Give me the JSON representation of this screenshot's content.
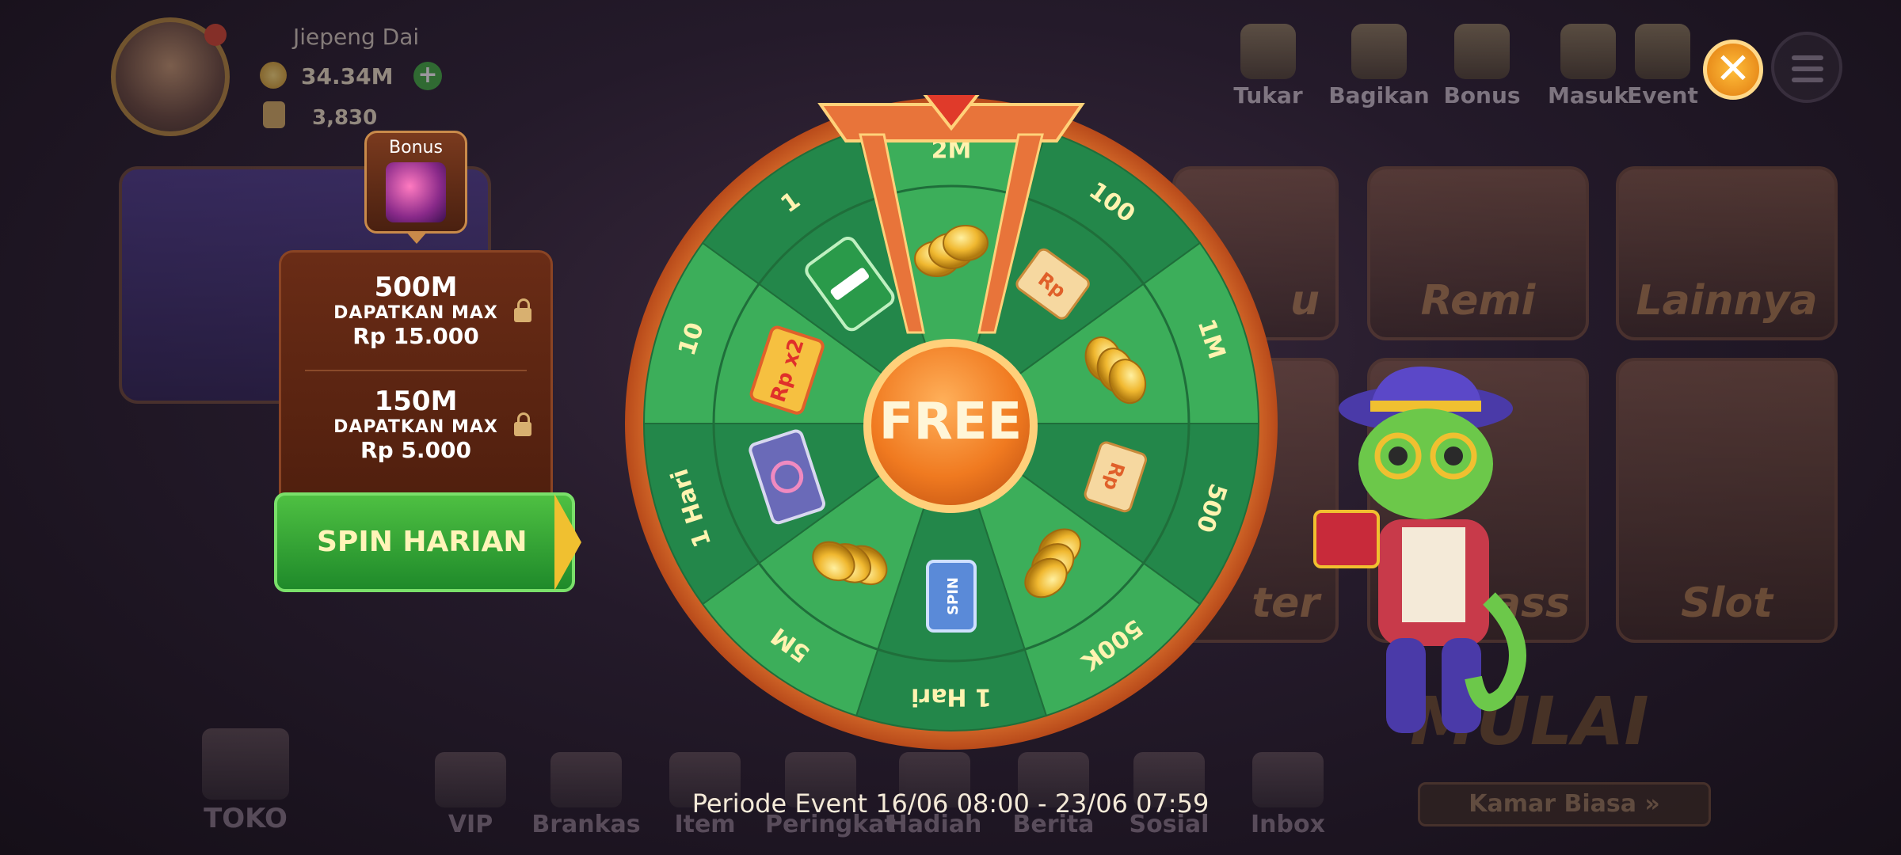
{
  "player": {
    "name": "Jiepeng Dai",
    "coins": "34.34M",
    "gems": "3,830"
  },
  "top_menu": [
    {
      "label": "Tukar",
      "icon": "exchange-icon"
    },
    {
      "label": "Bagikan",
      "icon": "share-icon"
    },
    {
      "label": "Bonus",
      "icon": "bonus-icon"
    },
    {
      "label": "Masuk",
      "icon": "checkin-icon"
    },
    {
      "label": "Event",
      "icon": "event-icon"
    }
  ],
  "games": [
    {
      "label": "Remi"
    },
    {
      "label": "Lainnya"
    },
    {
      "label": "Slot"
    },
    {
      "label": "ass"
    },
    {
      "label": "ter"
    },
    {
      "label": "u"
    }
  ],
  "bonus_popup": {
    "tab_label": "Bonus",
    "rewards": [
      {
        "amount": "500M",
        "subtitle": "DAPATKAN MAX",
        "rp": "Rp  15.000"
      },
      {
        "amount": "150M",
        "subtitle": "DAPATKAN MAX",
        "rp": "Rp  5.000"
      }
    ],
    "spin_button": "SPIN HARIAN"
  },
  "wheel": {
    "center_label": "FREE",
    "segments": [
      {
        "label": "2M",
        "prize": "coins"
      },
      {
        "label": "100",
        "prize": "rupiah"
      },
      {
        "label": "1M",
        "prize": "coins"
      },
      {
        "label": "500",
        "prize": "rupiah"
      },
      {
        "label": "500K",
        "prize": "coins"
      },
      {
        "label": "1 Hari",
        "prize": "spin-ticket"
      },
      {
        "label": "5M",
        "prize": "coins"
      },
      {
        "label": "1 Hari",
        "prize": "vip-card"
      },
      {
        "label": "10",
        "prize": "rp-x2-card"
      },
      {
        "label": "1",
        "prize": "domino-pack"
      }
    ],
    "spin_ticket_text": "SPIN",
    "x2_card_text": "Rp x2",
    "rp_text": "Rp"
  },
  "bottom_nav": [
    {
      "label": "TOKO"
    },
    {
      "label": "VIP"
    },
    {
      "label": "Brankas"
    },
    {
      "label": "Item"
    },
    {
      "label": "Peringkat"
    },
    {
      "label": "Hadiah"
    },
    {
      "label": "Berita"
    },
    {
      "label": "Sosial"
    },
    {
      "label": "Inbox"
    }
  ],
  "mulai": "MULAI",
  "kamar_biasa": "Kamar Biasa »",
  "periode_event": "Periode Event 16/06 08:00 - 23/06 07:59",
  "colors": {
    "wheel_green_light": "#3cae5a",
    "wheel_green_dark": "#23874a",
    "wheel_rim": "#e8743a",
    "gold": "#f6c040",
    "spin_green": "#3cb43c"
  }
}
